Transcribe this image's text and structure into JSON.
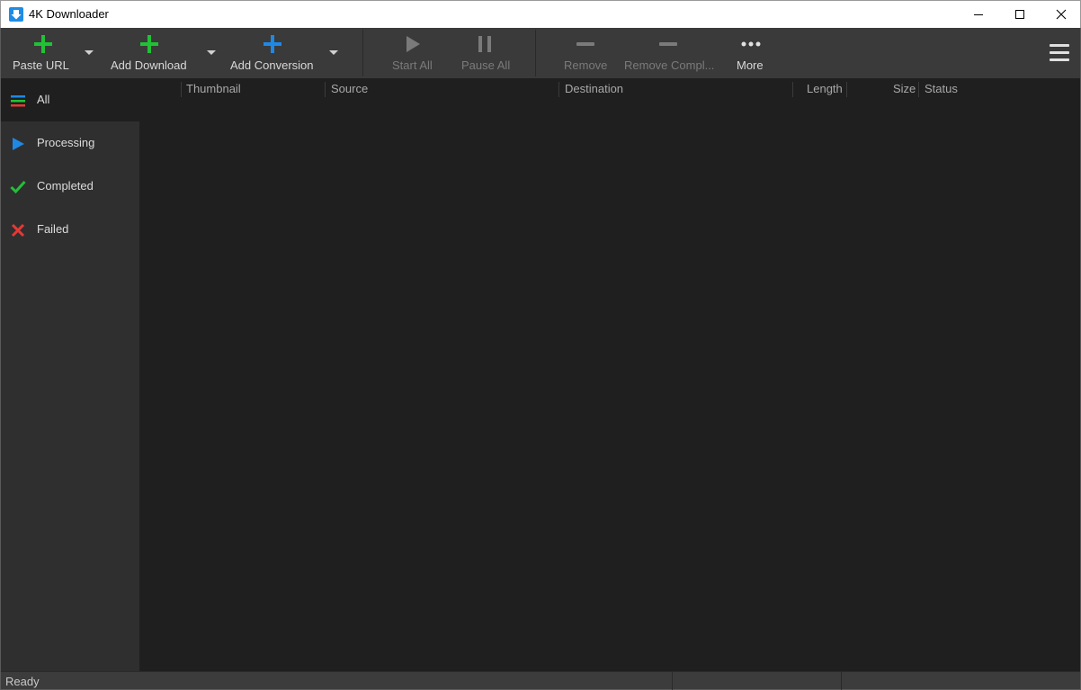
{
  "window": {
    "title": "4K Downloader"
  },
  "toolbar": {
    "paste_url": "Paste URL",
    "add_download": "Add Download",
    "add_conversion": "Add Conversion",
    "start_all": "Start All",
    "pause_all": "Pause All",
    "remove": "Remove",
    "remove_completed": "Remove Compl...",
    "more": "More"
  },
  "sidebar": {
    "items": [
      {
        "label": "All",
        "icon": "list-icon",
        "active": true
      },
      {
        "label": "Processing",
        "icon": "play-icon",
        "color": "#1e88e5"
      },
      {
        "label": "Completed",
        "icon": "check-icon",
        "color": "#2ecc40"
      },
      {
        "label": "Failed",
        "icon": "cross-icon",
        "color": "#e53935"
      }
    ]
  },
  "columns": {
    "thumbnail": "Thumbnail",
    "source": "Source",
    "destination": "Destination",
    "length": "Length",
    "size": "Size",
    "status": "Status"
  },
  "statusbar": {
    "text": "Ready"
  },
  "colors": {
    "green": "#21c136",
    "blue": "#1e88e5",
    "red": "#e53935",
    "background": "#1f1f1f",
    "toolbar": "#3a3a3a"
  }
}
